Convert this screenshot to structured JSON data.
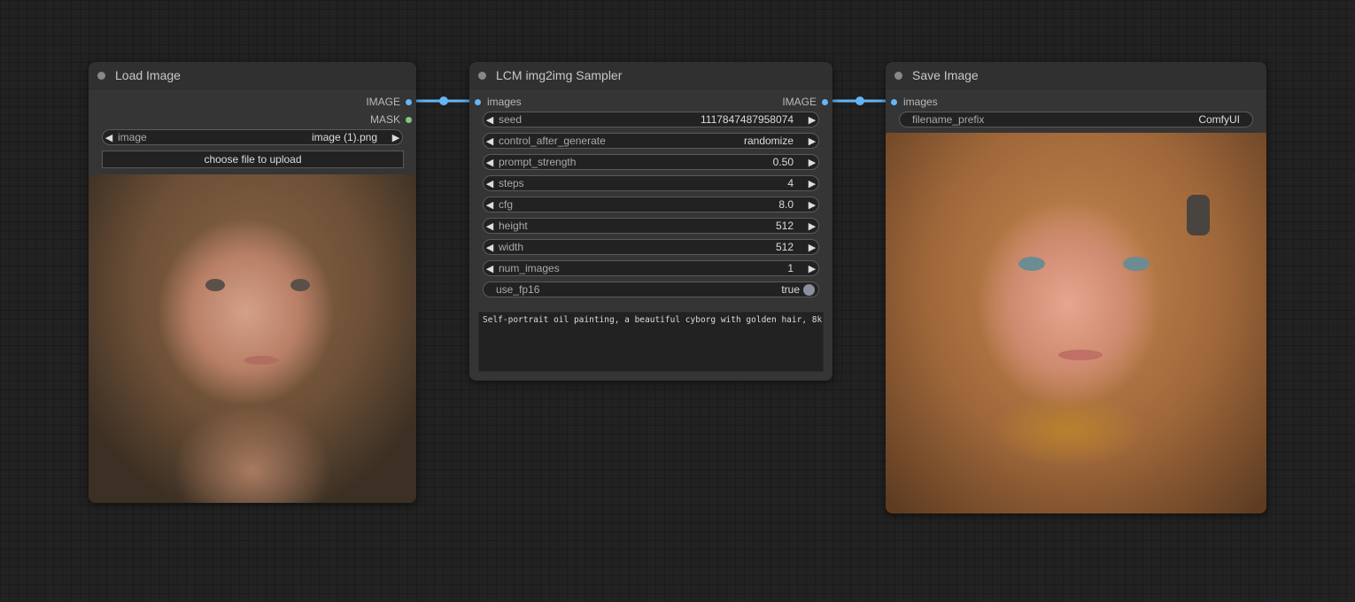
{
  "nodes": {
    "load_image": {
      "title": "Load Image",
      "outputs": [
        "IMAGE",
        "MASK"
      ],
      "image_widget": {
        "label": "image",
        "value": "image (1).png"
      },
      "upload_label": "choose file to upload",
      "preview_icon": "portrait-photo-girl"
    },
    "sampler": {
      "title": "LCM img2img Sampler",
      "input": "images",
      "output": "IMAGE",
      "widgets": [
        {
          "label": "seed",
          "value": "1117847487958074"
        },
        {
          "label": "control_after_generate",
          "value": "randomize"
        },
        {
          "label": "prompt_strength",
          "value": "0.50"
        },
        {
          "label": "steps",
          "value": "4"
        },
        {
          "label": "cfg",
          "value": "8.0"
        },
        {
          "label": "height",
          "value": "512"
        },
        {
          "label": "width",
          "value": "512"
        },
        {
          "label": "num_images",
          "value": "1"
        }
      ],
      "toggle": {
        "label": "use_fp16",
        "value": "true"
      },
      "prompt": "Self-portrait oil painting, a beautiful cyborg with golden hair, 8k"
    },
    "save_image": {
      "title": "Save Image",
      "input": "images",
      "widget": {
        "label": "filename_prefix",
        "value": "ComfyUI"
      },
      "preview_icon": "portrait-painting-cyborg"
    }
  },
  "colors": {
    "link": "#64b5f6",
    "image_slot": "#64b5f6",
    "mask_slot": "#81c784",
    "node_bg": "#353535",
    "canvas_bg": "#222222"
  }
}
